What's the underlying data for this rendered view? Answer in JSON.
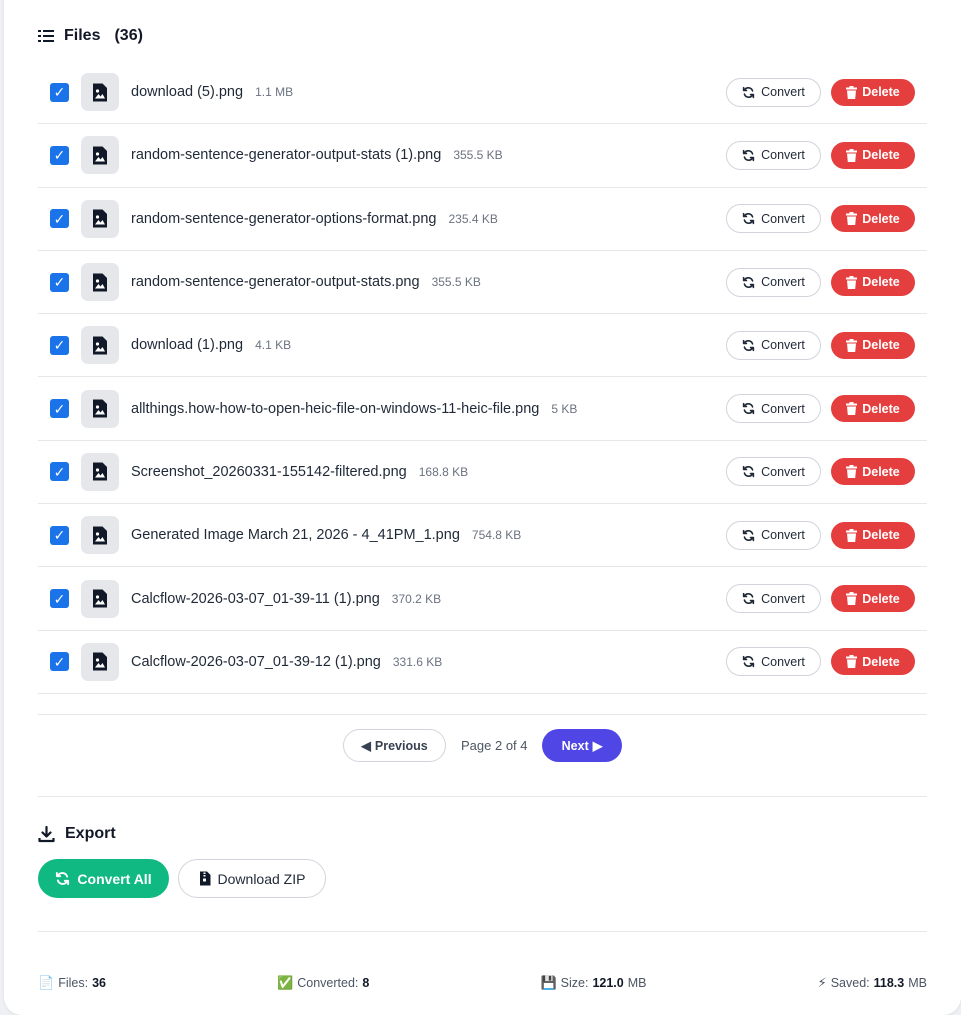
{
  "files_section": {
    "title": "Files",
    "count": "(36)"
  },
  "files": [
    {
      "name": "download (5).png",
      "size": "1.1 MB"
    },
    {
      "name": "random-sentence-generator-output-stats (1).png",
      "size": "355.5 KB"
    },
    {
      "name": "random-sentence-generator-options-format.png",
      "size": "235.4 KB"
    },
    {
      "name": "random-sentence-generator-output-stats.png",
      "size": "355.5 KB"
    },
    {
      "name": "download (1).png",
      "size": "4.1 KB"
    },
    {
      "name": "allthings.how-how-to-open-heic-file-on-windows-11-heic-file.png",
      "size": "5 KB"
    },
    {
      "name": "Screenshot_20260331-155142-filtered.png",
      "size": "168.8 KB"
    },
    {
      "name": "Generated Image March 21, 2026 - 4_41PM_1.png",
      "size": "754.8 KB"
    },
    {
      "name": "Calcflow-2026-03-07_01-39-11 (1).png",
      "size": "370.2 KB"
    },
    {
      "name": "Calcflow-2026-03-07_01-39-12 (1).png",
      "size": "331.6 KB"
    }
  ],
  "row_actions": {
    "convert_label": "Convert",
    "delete_label": "Delete"
  },
  "pagination": {
    "previous_label": "Previous",
    "page_info": "Page 2 of 4",
    "next_label": "Next"
  },
  "export_section": {
    "title": "Export",
    "convert_all_label": "Convert All",
    "download_zip_label": "Download ZIP"
  },
  "stats": {
    "files_label": "Files:",
    "files_value": "36",
    "converted_label": "Converted:",
    "converted_value": "8",
    "size_label": "Size:",
    "size_value": "121.0",
    "size_unit": "MB",
    "saved_label": "Saved:",
    "saved_value": "118.3",
    "saved_unit": "MB"
  },
  "colors": {
    "checkbox": "#1a73e8",
    "delete": "#e53e3e",
    "next": "#4f46e5",
    "convert_all": "#10b981"
  },
  "icons": {
    "list": "list-icon",
    "file": "file-image-icon",
    "convert": "refresh-icon",
    "delete": "trash-icon",
    "export": "download-icon",
    "zip": "zip-file-icon"
  }
}
